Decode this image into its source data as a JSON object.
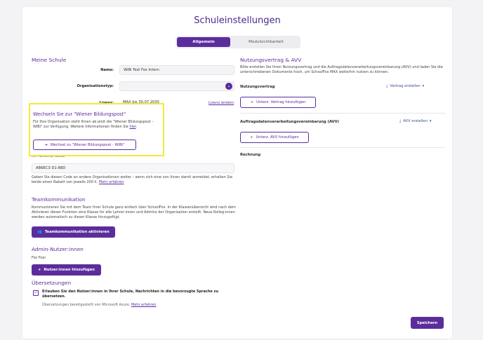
{
  "page": {
    "title": "Schuleinstellungen"
  },
  "tabs": [
    {
      "label": "Allgemein"
    },
    {
      "label": "Modulsichtbarkeit"
    }
  ],
  "school": {
    "heading": "Meine Schule",
    "name_label": "Name:",
    "name_value": "WiBi Test Fox Intern",
    "orgtype_label": "Organisationstyp:",
    "orgtype_value": "",
    "license_label": "Lizenz:",
    "license_value": "MAX bis 30.07.2035",
    "license_link": "Lizenz ändern"
  },
  "popup": {
    "title": "Wechseln Sie zur \"Wiener Bildungspost\"",
    "text_part1": "Für Ihre Organisation steht Ihnen ab jetzt die \"Wiener Bildungspost – WiBi\" zur Verfügung. Weitere Informationen finden Sie ",
    "text_link": "hier",
    "text_part2": ".",
    "button": "Wechsel zu \"Wiener Bildungspost - WiBi\""
  },
  "referral": {
    "label": "Ihr Referral-Code",
    "code": "AB6EC3-D1-88D",
    "text": "Geben Sie diesen Code an andere Organisationen weiter – wenn sich eine von ihnen damit anmeldet, erhalten Sie beide einen Rabatt von jeweils 200 €. ",
    "link": "Mehr erfahren"
  },
  "team": {
    "heading": "Teamkommunikation",
    "text": "Kommunizieren Sie mit dem Team Ihrer Schule ganz einfach über SchoolFox. In der Klassenübersicht wird nach dem Aktivieren dieser Funktion eine Klasse für alle Lehrer:innen und Admins der Organisation erstellt. Neue Kolleg:innen werden automatisch zu dieser Klasse hinzugefügt.",
    "button": "Teamkommunikation aktivieren"
  },
  "admins": {
    "heading": "Admin-Nutzer:innen",
    "user": "Fixi Foxi",
    "button": "Nutzer:innen hinzufügen"
  },
  "translations": {
    "heading": "Übersetzungen",
    "check_text": "Erlauben Sie den Nutzer:innen in Ihrer Schule, Nachrichten in die bevorzugte Sprache zu übersetzen.",
    "note": "Übersetzungen bereitgestellt von Microsoft Azure. ",
    "link": "Mehr erfahren"
  },
  "contracts": {
    "heading": "Nutzungsvertrag & AVV",
    "text": "Bitte erstellen Sie Ihren Nutzungsvertrag und die Auftragsdatenverarbeitungsvereinbarung (AVV) und laden Sie die unterschriebenen Dokumente hoch, um SchoolFox MAX weiterhin nutzen zu können.",
    "nv_label": "Nutzungsvertrag",
    "nv_create": "Vertrag erstellen",
    "nv_add": "Unterz. Vertrag hinzufügen",
    "avv_label": "Auftragsdatenverarbeitungsvereinbarung (AVV)",
    "avv_create": "AVV erstellen",
    "avv_add": "Unterz. AVV hinzufügen",
    "invoice_label": "Rechnung"
  },
  "save_button": "Speichern",
  "colors": {
    "accent": "#5b2d9c",
    "highlight": "#f3e93a"
  },
  "icons": [
    "chevron-down-icon",
    "plus-icon",
    "download-icon",
    "arrow-right-circle-icon",
    "team-icon",
    "checkbox-icon"
  ]
}
